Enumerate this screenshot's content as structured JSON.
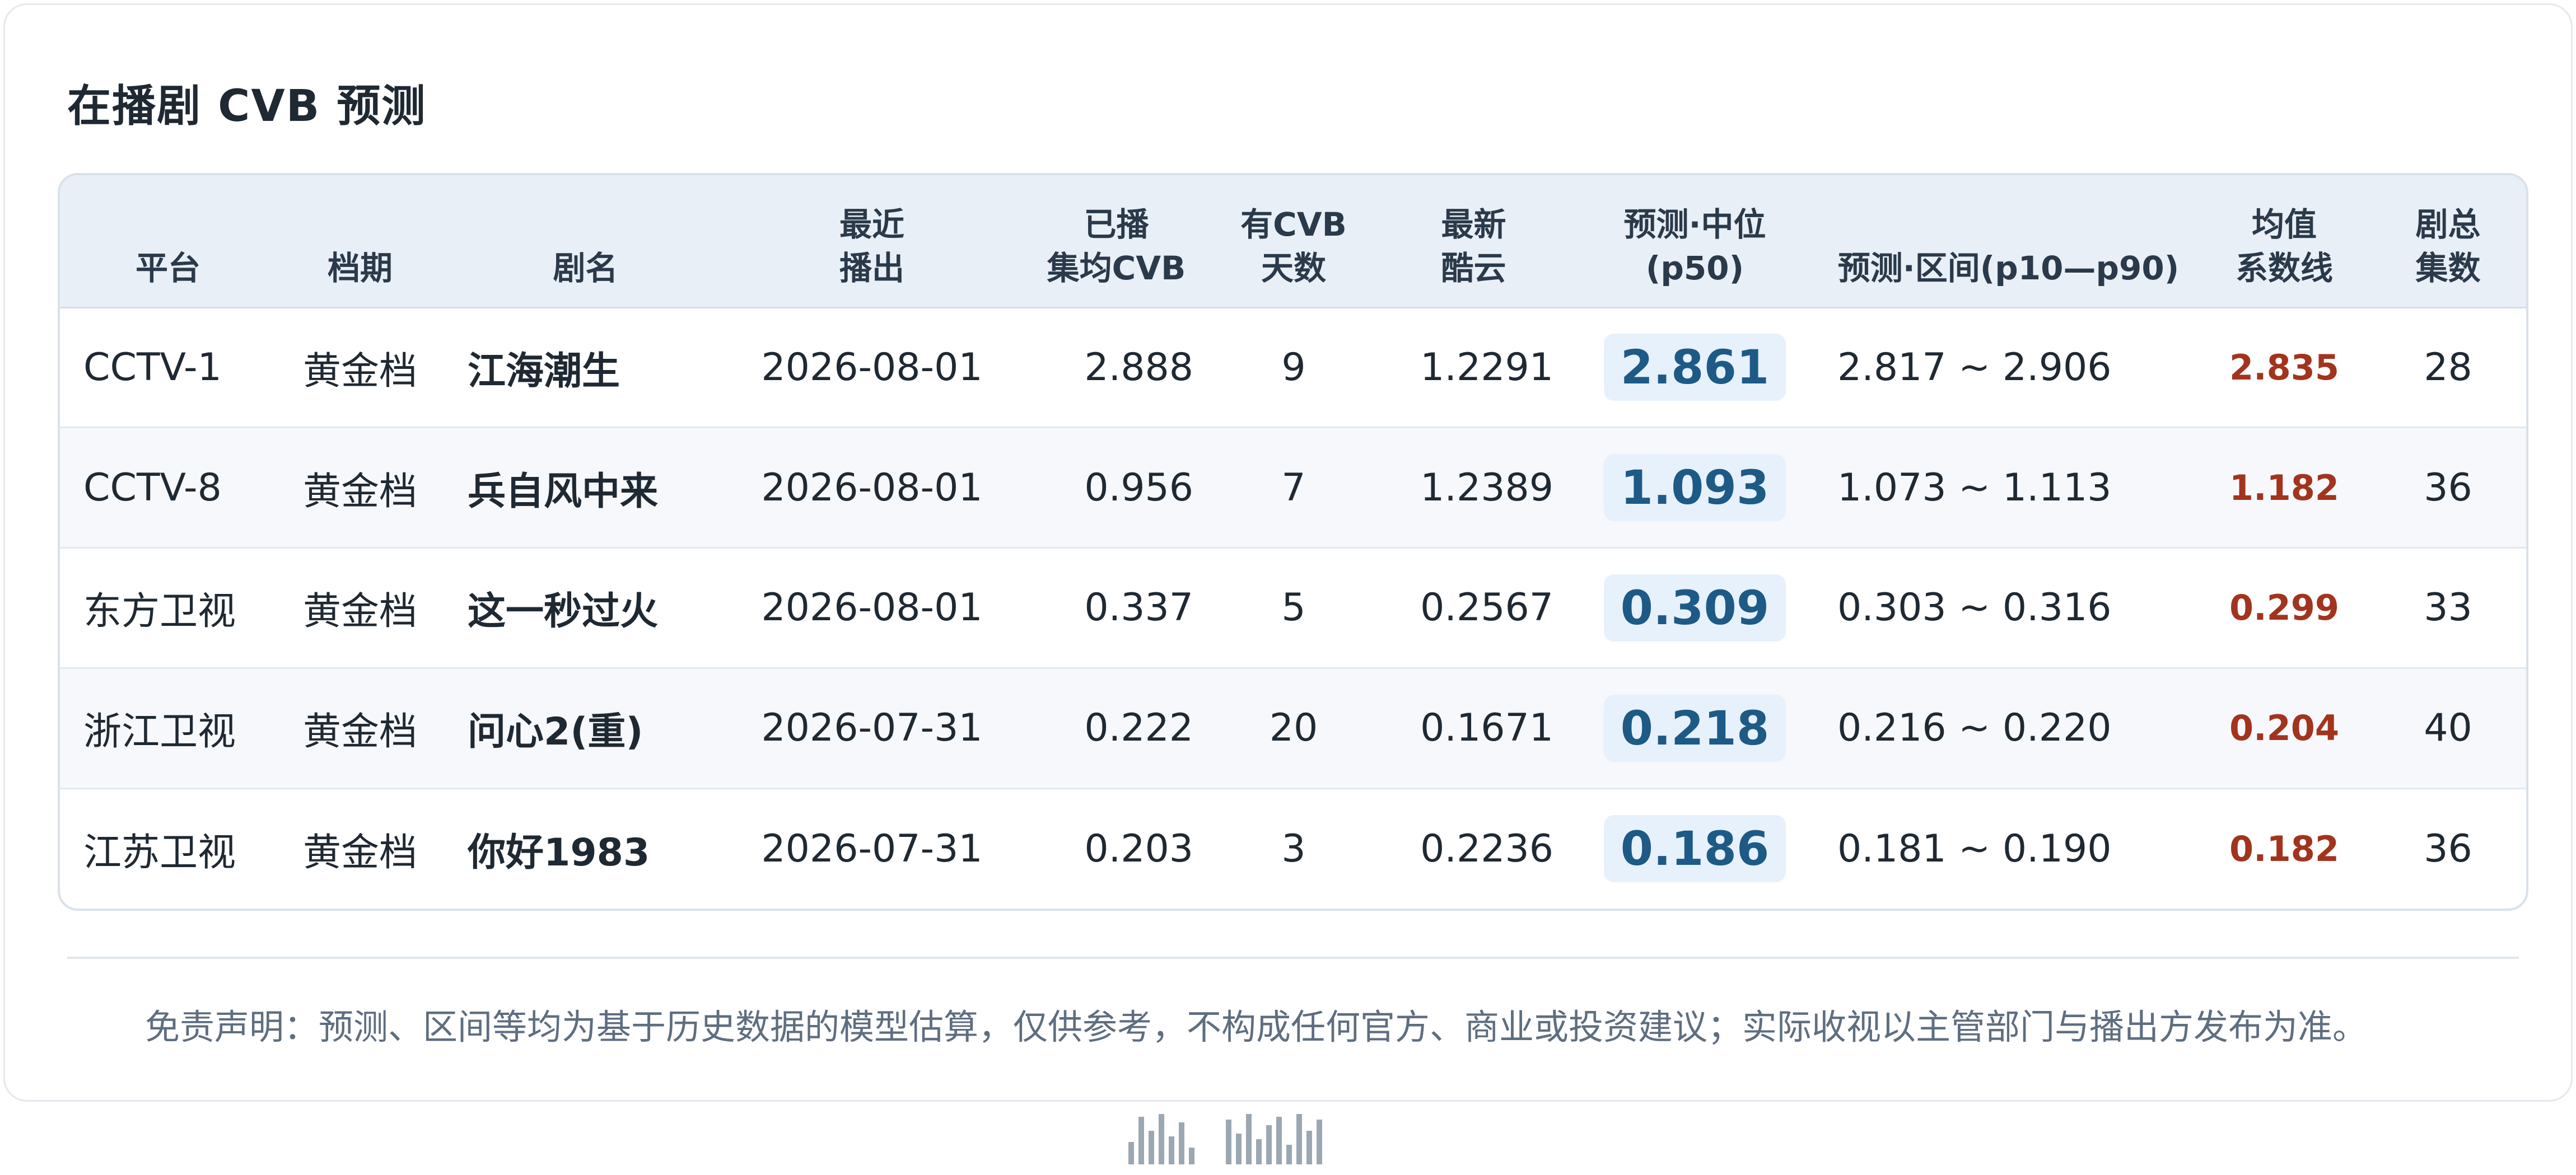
{
  "title": "在播剧 CVB 预测",
  "columns": {
    "platform": "平台",
    "slot": "档期",
    "name": "剧名",
    "last_air_1": "最近",
    "last_air_2": "播出",
    "aired_avg_1": "已播",
    "aired_avg_2": "集均CVB",
    "cvb_days_1": "有CVB",
    "cvb_days_2": "天数",
    "latest_ky_1": "最新",
    "latest_ky_2": "酷云",
    "p50_1": "预测·中位",
    "p50_2": "(p50)",
    "range": "预测·区间(p10—p90)",
    "mean_line_1": "均值",
    "mean_line_2": "系数线",
    "episodes_1": "剧总",
    "episodes_2": "集数"
  },
  "rows": [
    {
      "platform": "CCTV-1",
      "slot": "黄金档",
      "name": "江海潮生",
      "last_air": "2026-08-01",
      "aired_avg": "2.888",
      "cvb_days": "9",
      "latest_ky": "1.2291",
      "p50": "2.861",
      "range": "2.817 ~ 2.906",
      "mean_line": "2.835",
      "episodes": "28"
    },
    {
      "platform": "CCTV-8",
      "slot": "黄金档",
      "name": "兵自风中来",
      "last_air": "2026-08-01",
      "aired_avg": "0.956",
      "cvb_days": "7",
      "latest_ky": "1.2389",
      "p50": "1.093",
      "range": "1.073 ~ 1.113",
      "mean_line": "1.182",
      "episodes": "36"
    },
    {
      "platform": "东方卫视",
      "slot": "黄金档",
      "name": "这一秒过火",
      "last_air": "2026-08-01",
      "aired_avg": "0.337",
      "cvb_days": "5",
      "latest_ky": "0.2567",
      "p50": "0.309",
      "range": "0.303 ~ 0.316",
      "mean_line": "0.299",
      "episodes": "33"
    },
    {
      "platform": "浙江卫视",
      "slot": "黄金档",
      "name": "问心2(重)",
      "last_air": "2026-07-31",
      "aired_avg": "0.222",
      "cvb_days": "20",
      "latest_ky": "0.1671",
      "p50": "0.218",
      "range": "0.216 ~ 0.220",
      "mean_line": "0.204",
      "episodes": "40"
    },
    {
      "platform": "江苏卫视",
      "slot": "黄金档",
      "name": "你好1983",
      "last_air": "2026-07-31",
      "aired_avg": "0.203",
      "cvb_days": "3",
      "latest_ky": "0.2236",
      "p50": "0.186",
      "range": "0.181 ~ 0.190",
      "mean_line": "0.182",
      "episodes": "36"
    }
  ],
  "disclaimer": "免责声明：预测、区间等均为基于历史数据的模型估算，仅供参考，不构成任何官方、商业或投资建议；实际收视以主管部门与播出方发布为准。",
  "colors": {
    "header_bg": "#e9eff6",
    "p50_chip_bg": "#e7f1fb",
    "p50_text": "#1d5a86",
    "mean_line_text": "#a2341e"
  }
}
